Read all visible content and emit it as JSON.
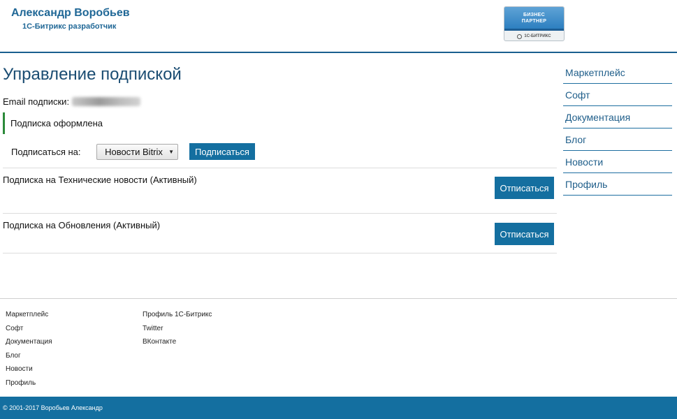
{
  "header": {
    "title": "Александр Воробьев",
    "subtitle": "1С-Битрикс разработчик",
    "partner_badge": {
      "line1": "БИЗНЕС",
      "line2": "ПАРТНЕР",
      "bottom": "1С-БИТРИКС",
      "colors": {
        "top": "#2d7fc0",
        "stripe": "#1d5e95"
      }
    }
  },
  "main": {
    "page_title": "Управление подпиской",
    "email_label": "Email подписки:",
    "email_value": "mvorai@mail.ru",
    "notice": "Подписка оформлена",
    "subscribe_label": "Подписаться на:",
    "select_value": "Новости Bitrix",
    "subscribe_button": "Подписаться",
    "subscriptions": [
      {
        "text": "Подписка на Технические новости (Активный)",
        "button": "Отписаться"
      },
      {
        "text": "Подписка на Обновления (Активный)",
        "button": "Отписаться"
      }
    ]
  },
  "sidebar": {
    "items": [
      "Маркетплейс",
      "Софт",
      "Документация",
      "Блог",
      "Новости",
      "Профиль"
    ]
  },
  "footer": {
    "col1": [
      "Маркетплейс",
      "Софт",
      "Документация",
      "Блог",
      "Новости",
      "Профиль"
    ],
    "col2": [
      "Профиль 1С-Битрикс",
      "Twitter",
      "ВКонтакте"
    ],
    "copyright": "© 2001-2017 Воробьев Александр"
  },
  "colors": {
    "accent": "#146fa0",
    "title": "#1a4c72",
    "notice_border": "#2c8a3a"
  }
}
